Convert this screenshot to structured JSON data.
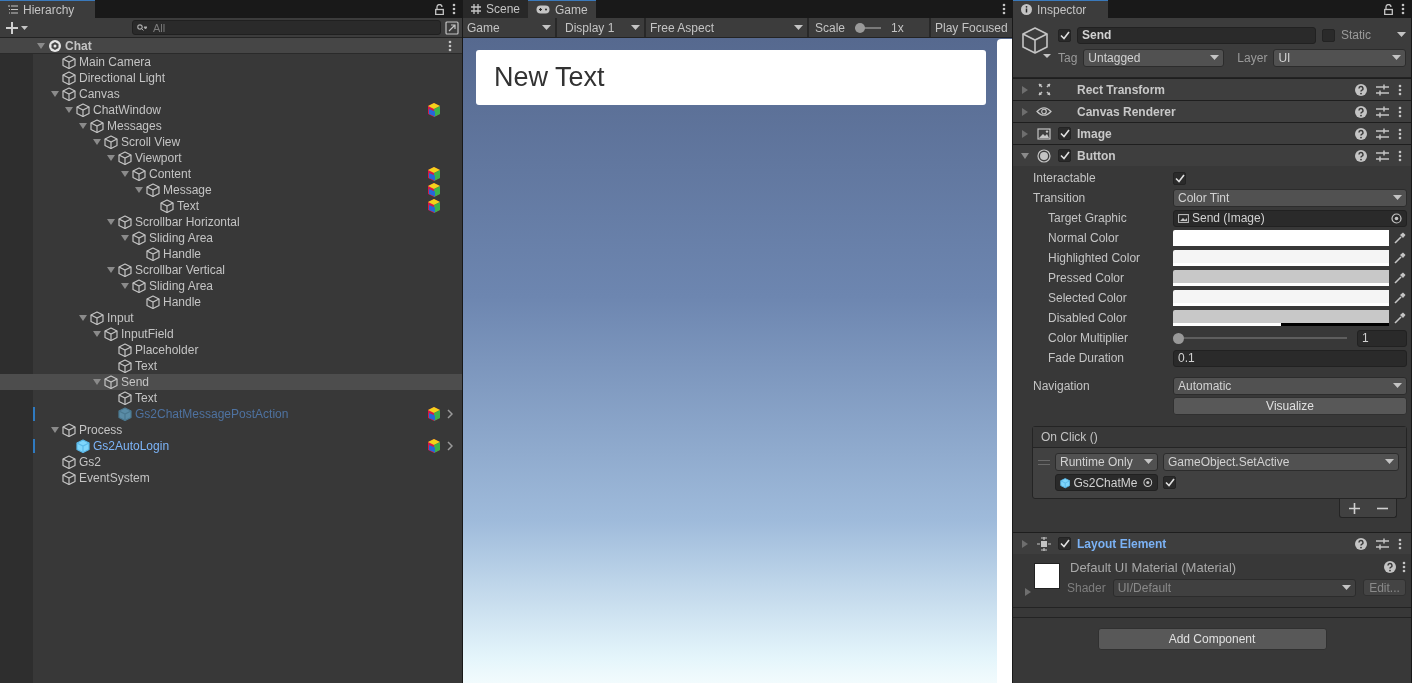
{
  "hierarchy": {
    "title": "Hierarchy",
    "search": {
      "placeholder": "All"
    },
    "tree": [
      {
        "label": "Chat",
        "kind": "scene",
        "expanded": true,
        "selected": false,
        "badge": false,
        "children": [
          {
            "label": "Main Camera",
            "kind": "object",
            "selected": false,
            "badge": false
          },
          {
            "label": "Directional Light",
            "kind": "object",
            "selected": false,
            "badge": false
          },
          {
            "label": "Canvas",
            "kind": "object",
            "expanded": true,
            "selected": false,
            "badge": false,
            "children": [
              {
                "label": "ChatWindow",
                "kind": "object",
                "expanded": true,
                "selected": false,
                "badge": true,
                "children": [
                  {
                    "label": "Messages",
                    "kind": "object",
                    "expanded": true,
                    "selected": false,
                    "badge": false,
                    "children": [
                      {
                        "label": "Scroll View",
                        "kind": "object",
                        "expanded": true,
                        "selected": false,
                        "badge": false,
                        "children": [
                          {
                            "label": "Viewport",
                            "kind": "object",
                            "expanded": true,
                            "selected": false,
                            "badge": false,
                            "children": [
                              {
                                "label": "Content",
                                "kind": "object",
                                "expanded": true,
                                "selected": false,
                                "badge": true,
                                "children": [
                                  {
                                    "label": "Message",
                                    "kind": "object",
                                    "expanded": true,
                                    "selected": false,
                                    "badge": true,
                                    "children": [
                                      {
                                        "label": "Text",
                                        "kind": "object",
                                        "selected": false,
                                        "badge": true
                                      }
                                    ]
                                  }
                                ]
                              }
                            ]
                          },
                          {
                            "label": "Scrollbar Horizontal",
                            "kind": "object",
                            "expanded": true,
                            "selected": false,
                            "badge": false,
                            "children": [
                              {
                                "label": "Sliding Area",
                                "kind": "object",
                                "expanded": true,
                                "selected": false,
                                "badge": false,
                                "children": [
                                  {
                                    "label": "Handle",
                                    "kind": "object",
                                    "selected": false,
                                    "badge": false
                                  }
                                ]
                              }
                            ]
                          },
                          {
                            "label": "Scrollbar Vertical",
                            "kind": "object",
                            "expanded": true,
                            "selected": false,
                            "badge": false,
                            "children": [
                              {
                                "label": "Sliding Area",
                                "kind": "object",
                                "expanded": true,
                                "selected": false,
                                "badge": false,
                                "children": [
                                  {
                                    "label": "Handle",
                                    "kind": "object",
                                    "selected": false,
                                    "badge": false
                                  }
                                ]
                              }
                            ]
                          }
                        ]
                      }
                    ]
                  },
                  {
                    "label": "Input",
                    "kind": "object",
                    "expanded": true,
                    "selected": false,
                    "badge": false,
                    "children": [
                      {
                        "label": "InputField",
                        "kind": "object",
                        "expanded": true,
                        "selected": false,
                        "badge": false,
                        "children": [
                          {
                            "label": "Placeholder",
                            "kind": "object",
                            "selected": false,
                            "badge": false
                          },
                          {
                            "label": "Text",
                            "kind": "object",
                            "selected": false,
                            "badge": false
                          }
                        ]
                      },
                      {
                        "label": "Send",
                        "kind": "object",
                        "expanded": true,
                        "selected": true,
                        "badge": false,
                        "children": [
                          {
                            "label": "Text",
                            "kind": "object",
                            "selected": false,
                            "badge": false
                          },
                          {
                            "label": "Gs2ChatMessagePostAction",
                            "kind": "prefab_faded",
                            "selected": false,
                            "badge": true
                          }
                        ]
                      }
                    ]
                  }
                ]
              }
            ]
          },
          {
            "label": "Process",
            "kind": "object",
            "expanded": true,
            "selected": false,
            "badge": false,
            "children": [
              {
                "label": "Gs2AutoLogin",
                "kind": "prefab",
                "selected": false,
                "badge": true
              }
            ]
          },
          {
            "label": "Gs2",
            "kind": "object",
            "selected": false,
            "badge": false
          },
          {
            "label": "EventSystem",
            "kind": "object",
            "selected": false,
            "badge": false
          }
        ]
      }
    ]
  },
  "game_view": {
    "tabs": [
      {
        "label": "Scene",
        "kind": "scene",
        "selected": false
      },
      {
        "label": "Game",
        "kind": "game",
        "selected": true
      }
    ],
    "toolbar": {
      "mode": "Game",
      "display": "Display 1",
      "aspect": "Free Aspect",
      "scale": {
        "label": "Scale",
        "level": 0,
        "reading": "1x"
      },
      "play_mode": "Play Focused"
    },
    "text": "New Text"
  },
  "inspector": {
    "title": "Inspector",
    "object": {
      "active": true,
      "name": "Send",
      "static": false,
      "static_label": "Static",
      "tag_label": "Tag",
      "tag": "Untagged",
      "layer_label": "Layer",
      "layer": "UI"
    },
    "components": [
      {
        "name": "Rect Transform",
        "kind": "transform",
        "expanded": false,
        "overridden": false
      },
      {
        "name": "Canvas Renderer",
        "kind": "renderer",
        "expanded": false,
        "overridden": false
      },
      {
        "name": "Image",
        "kind": "image",
        "enabled": true,
        "expanded": false,
        "overridden": false
      },
      {
        "name": "Button",
        "kind": "button",
        "enabled": true,
        "expanded": true,
        "overridden": false,
        "fields": [
          {
            "kind": "check",
            "label": "Interactable",
            "checked": true
          },
          {
            "kind": "dropdown",
            "label": "Transition",
            "value": "Color Tint",
            "children": [
              {
                "kind": "object",
                "label": "Target Graphic",
                "value": "Send (Image)"
              },
              {
                "kind": "color",
                "label": "Normal Color",
                "color": "#ffffff",
                "level": 1
              },
              {
                "kind": "color",
                "label": "Highlighted Color",
                "color": "#f5f5f5",
                "level": 1
              },
              {
                "kind": "color",
                "label": "Pressed Color",
                "color": "#c8c8c8",
                "level": 1
              },
              {
                "kind": "color",
                "label": "Selected Color",
                "color": "#f5f5f5",
                "level": 1
              },
              {
                "kind": "color",
                "label": "Disabled Color",
                "color": "#c8c8c8",
                "level": 0.5
              },
              {
                "kind": "slider",
                "label": "Color Multiplier",
                "level": 0,
                "value": "1"
              },
              {
                "kind": "number",
                "label": "Fade Duration",
                "value": "0.1"
              }
            ]
          },
          {
            "kind": "dropdown",
            "label": "Navigation",
            "value": "Automatic"
          },
          {
            "kind": "button",
            "label": "Visualize"
          }
        ],
        "event": {
          "title": "On Click ()",
          "calls": [
            {
              "mode": "Runtime Only",
              "function": "GameObject.SetActive",
              "target": "Gs2ChatMe",
              "argument_checked": true
            }
          ]
        }
      },
      {
        "name": "Layout Element",
        "kind": "layout",
        "enabled": true,
        "expanded": false,
        "overridden": true
      }
    ],
    "material": {
      "name": "Default UI Material (Material)",
      "shader_label": "Shader",
      "shader": "UI/Default",
      "edit": "Edit..."
    },
    "add_component": "Add Component"
  }
}
